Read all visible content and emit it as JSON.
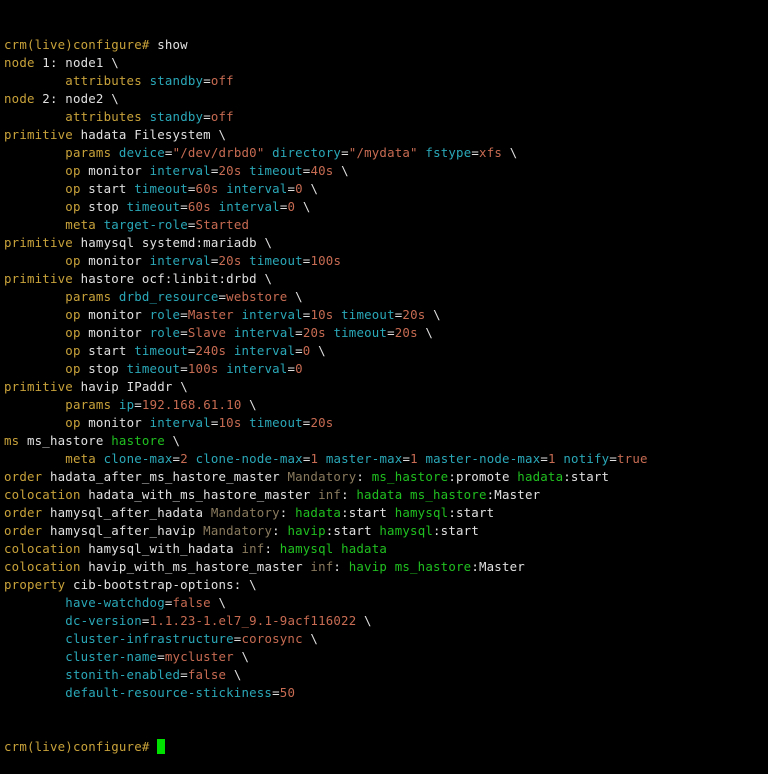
{
  "colors": {
    "background": "#000000",
    "plain": "#e0e0e0",
    "keyword": "#c8a23a",
    "attribute": "#2aa8b8",
    "value": "#c76b52",
    "reference": "#20c020",
    "mandatory": "#8a7b5e",
    "cursor": "#00e000"
  },
  "terminal": {
    "lines": [
      [
        [
          "crm(live)configure#",
          "keyword"
        ],
        [
          " show",
          "plain"
        ]
      ],
      [
        [
          "node",
          "keyword"
        ],
        [
          " 1: node1 \\",
          "plain"
        ]
      ],
      [
        [
          "        ",
          "plain"
        ],
        [
          "attributes",
          "keyword"
        ],
        [
          " ",
          "plain"
        ],
        [
          "standby",
          "attribute"
        ],
        [
          "=",
          "plain"
        ],
        [
          "off",
          "value"
        ]
      ],
      [
        [
          "node",
          "keyword"
        ],
        [
          " 2: node2 \\",
          "plain"
        ]
      ],
      [
        [
          "        ",
          "plain"
        ],
        [
          "attributes",
          "keyword"
        ],
        [
          " ",
          "plain"
        ],
        [
          "standby",
          "attribute"
        ],
        [
          "=",
          "plain"
        ],
        [
          "off",
          "value"
        ]
      ],
      [
        [
          "primitive",
          "keyword"
        ],
        [
          " hadata Filesystem \\",
          "plain"
        ]
      ],
      [
        [
          "        ",
          "plain"
        ],
        [
          "params",
          "keyword"
        ],
        [
          " ",
          "plain"
        ],
        [
          "device",
          "attribute"
        ],
        [
          "=",
          "plain"
        ],
        [
          "\"/dev/drbd0\"",
          "value"
        ],
        [
          " ",
          "plain"
        ],
        [
          "directory",
          "attribute"
        ],
        [
          "=",
          "plain"
        ],
        [
          "\"/mydata\"",
          "value"
        ],
        [
          " ",
          "plain"
        ],
        [
          "fstype",
          "attribute"
        ],
        [
          "=",
          "plain"
        ],
        [
          "xfs",
          "value"
        ],
        [
          " \\",
          "plain"
        ]
      ],
      [
        [
          "        ",
          "plain"
        ],
        [
          "op",
          "keyword"
        ],
        [
          " monitor ",
          "plain"
        ],
        [
          "interval",
          "attribute"
        ],
        [
          "=",
          "plain"
        ],
        [
          "20s",
          "value"
        ],
        [
          " ",
          "plain"
        ],
        [
          "timeout",
          "attribute"
        ],
        [
          "=",
          "plain"
        ],
        [
          "40s",
          "value"
        ],
        [
          " \\",
          "plain"
        ]
      ],
      [
        [
          "        ",
          "plain"
        ],
        [
          "op",
          "keyword"
        ],
        [
          " start ",
          "plain"
        ],
        [
          "timeout",
          "attribute"
        ],
        [
          "=",
          "plain"
        ],
        [
          "60s",
          "value"
        ],
        [
          " ",
          "plain"
        ],
        [
          "interval",
          "attribute"
        ],
        [
          "=",
          "plain"
        ],
        [
          "0",
          "value"
        ],
        [
          " \\",
          "plain"
        ]
      ],
      [
        [
          "        ",
          "plain"
        ],
        [
          "op",
          "keyword"
        ],
        [
          " stop ",
          "plain"
        ],
        [
          "timeout",
          "attribute"
        ],
        [
          "=",
          "plain"
        ],
        [
          "60s",
          "value"
        ],
        [
          " ",
          "plain"
        ],
        [
          "interval",
          "attribute"
        ],
        [
          "=",
          "plain"
        ],
        [
          "0",
          "value"
        ],
        [
          " \\",
          "plain"
        ]
      ],
      [
        [
          "        ",
          "plain"
        ],
        [
          "meta",
          "keyword"
        ],
        [
          " ",
          "plain"
        ],
        [
          "target-role",
          "attribute"
        ],
        [
          "=",
          "plain"
        ],
        [
          "Started",
          "value"
        ]
      ],
      [
        [
          "primitive",
          "keyword"
        ],
        [
          " hamysql systemd:mariadb \\",
          "plain"
        ]
      ],
      [
        [
          "        ",
          "plain"
        ],
        [
          "op",
          "keyword"
        ],
        [
          " monitor ",
          "plain"
        ],
        [
          "interval",
          "attribute"
        ],
        [
          "=",
          "plain"
        ],
        [
          "20s",
          "value"
        ],
        [
          " ",
          "plain"
        ],
        [
          "timeout",
          "attribute"
        ],
        [
          "=",
          "plain"
        ],
        [
          "100s",
          "value"
        ]
      ],
      [
        [
          "primitive",
          "keyword"
        ],
        [
          " hastore ocf:linbit:drbd \\",
          "plain"
        ]
      ],
      [
        [
          "        ",
          "plain"
        ],
        [
          "params",
          "keyword"
        ],
        [
          " ",
          "plain"
        ],
        [
          "drbd_resource",
          "attribute"
        ],
        [
          "=",
          "plain"
        ],
        [
          "webstore",
          "value"
        ],
        [
          " \\",
          "plain"
        ]
      ],
      [
        [
          "        ",
          "plain"
        ],
        [
          "op",
          "keyword"
        ],
        [
          " monitor ",
          "plain"
        ],
        [
          "role",
          "attribute"
        ],
        [
          "=",
          "plain"
        ],
        [
          "Master",
          "value"
        ],
        [
          " ",
          "plain"
        ],
        [
          "interval",
          "attribute"
        ],
        [
          "=",
          "plain"
        ],
        [
          "10s",
          "value"
        ],
        [
          " ",
          "plain"
        ],
        [
          "timeout",
          "attribute"
        ],
        [
          "=",
          "plain"
        ],
        [
          "20s",
          "value"
        ],
        [
          " \\",
          "plain"
        ]
      ],
      [
        [
          "        ",
          "plain"
        ],
        [
          "op",
          "keyword"
        ],
        [
          " monitor ",
          "plain"
        ],
        [
          "role",
          "attribute"
        ],
        [
          "=",
          "plain"
        ],
        [
          "Slave",
          "value"
        ],
        [
          " ",
          "plain"
        ],
        [
          "interval",
          "attribute"
        ],
        [
          "=",
          "plain"
        ],
        [
          "20s",
          "value"
        ],
        [
          " ",
          "plain"
        ],
        [
          "timeout",
          "attribute"
        ],
        [
          "=",
          "plain"
        ],
        [
          "20s",
          "value"
        ],
        [
          " \\",
          "plain"
        ]
      ],
      [
        [
          "        ",
          "plain"
        ],
        [
          "op",
          "keyword"
        ],
        [
          " start ",
          "plain"
        ],
        [
          "timeout",
          "attribute"
        ],
        [
          "=",
          "plain"
        ],
        [
          "240s",
          "value"
        ],
        [
          " ",
          "plain"
        ],
        [
          "interval",
          "attribute"
        ],
        [
          "=",
          "plain"
        ],
        [
          "0",
          "value"
        ],
        [
          " \\",
          "plain"
        ]
      ],
      [
        [
          "        ",
          "plain"
        ],
        [
          "op",
          "keyword"
        ],
        [
          " stop ",
          "plain"
        ],
        [
          "timeout",
          "attribute"
        ],
        [
          "=",
          "plain"
        ],
        [
          "100s",
          "value"
        ],
        [
          " ",
          "plain"
        ],
        [
          "interval",
          "attribute"
        ],
        [
          "=",
          "plain"
        ],
        [
          "0",
          "value"
        ]
      ],
      [
        [
          "primitive",
          "keyword"
        ],
        [
          " havip IPaddr \\",
          "plain"
        ]
      ],
      [
        [
          "        ",
          "plain"
        ],
        [
          "params",
          "keyword"
        ],
        [
          " ",
          "plain"
        ],
        [
          "ip",
          "attribute"
        ],
        [
          "=",
          "plain"
        ],
        [
          "192.168.61.10",
          "value"
        ],
        [
          " \\",
          "plain"
        ]
      ],
      [
        [
          "        ",
          "plain"
        ],
        [
          "op",
          "keyword"
        ],
        [
          " monitor ",
          "plain"
        ],
        [
          "interval",
          "attribute"
        ],
        [
          "=",
          "plain"
        ],
        [
          "10s",
          "value"
        ],
        [
          " ",
          "plain"
        ],
        [
          "timeout",
          "attribute"
        ],
        [
          "=",
          "plain"
        ],
        [
          "20s",
          "value"
        ]
      ],
      [
        [
          "ms",
          "keyword"
        ],
        [
          " ms_hastore ",
          "plain"
        ],
        [
          "hastore",
          "reference"
        ],
        [
          " \\",
          "plain"
        ]
      ],
      [
        [
          "        ",
          "plain"
        ],
        [
          "meta",
          "keyword"
        ],
        [
          " ",
          "plain"
        ],
        [
          "clone-max",
          "attribute"
        ],
        [
          "=",
          "plain"
        ],
        [
          "2",
          "value"
        ],
        [
          " ",
          "plain"
        ],
        [
          "clone-node-max",
          "attribute"
        ],
        [
          "=",
          "plain"
        ],
        [
          "1",
          "value"
        ],
        [
          " ",
          "plain"
        ],
        [
          "master-max",
          "attribute"
        ],
        [
          "=",
          "plain"
        ],
        [
          "1",
          "value"
        ],
        [
          " ",
          "plain"
        ],
        [
          "master-node-max",
          "attribute"
        ],
        [
          "=",
          "plain"
        ],
        [
          "1",
          "value"
        ],
        [
          " ",
          "plain"
        ],
        [
          "notify",
          "attribute"
        ],
        [
          "=",
          "plain"
        ],
        [
          "true",
          "value"
        ]
      ],
      [
        [
          "order",
          "keyword"
        ],
        [
          " hadata_after_ms_hastore_master ",
          "plain"
        ],
        [
          "Mandatory",
          "mandatory"
        ],
        [
          ": ",
          "plain"
        ],
        [
          "ms_hastore",
          "reference"
        ],
        [
          ":promote ",
          "plain"
        ],
        [
          "hadata",
          "reference"
        ],
        [
          ":start",
          "plain"
        ]
      ],
      [
        [
          "colocation",
          "keyword"
        ],
        [
          " hadata_with_ms_hastore_master ",
          "plain"
        ],
        [
          "inf",
          "mandatory"
        ],
        [
          ": ",
          "plain"
        ],
        [
          "hadata",
          "reference"
        ],
        [
          " ",
          "plain"
        ],
        [
          "ms_hastore",
          "reference"
        ],
        [
          ":Master",
          "plain"
        ]
      ],
      [
        [
          "order",
          "keyword"
        ],
        [
          " hamysql_after_hadata ",
          "plain"
        ],
        [
          "Mandatory",
          "mandatory"
        ],
        [
          ": ",
          "plain"
        ],
        [
          "hadata",
          "reference"
        ],
        [
          ":start ",
          "plain"
        ],
        [
          "hamysql",
          "reference"
        ],
        [
          ":start",
          "plain"
        ]
      ],
      [
        [
          "order",
          "keyword"
        ],
        [
          " hamysql_after_havip ",
          "plain"
        ],
        [
          "Mandatory",
          "mandatory"
        ],
        [
          ": ",
          "plain"
        ],
        [
          "havip",
          "reference"
        ],
        [
          ":start ",
          "plain"
        ],
        [
          "hamysql",
          "reference"
        ],
        [
          ":start",
          "plain"
        ]
      ],
      [
        [
          "colocation",
          "keyword"
        ],
        [
          " hamysql_with_hadata ",
          "plain"
        ],
        [
          "inf",
          "mandatory"
        ],
        [
          ": ",
          "plain"
        ],
        [
          "hamysql",
          "reference"
        ],
        [
          " ",
          "plain"
        ],
        [
          "hadata",
          "reference"
        ]
      ],
      [
        [
          "colocation",
          "keyword"
        ],
        [
          " havip_with_ms_hastore_master ",
          "plain"
        ],
        [
          "inf",
          "mandatory"
        ],
        [
          ": ",
          "plain"
        ],
        [
          "havip",
          "reference"
        ],
        [
          " ",
          "plain"
        ],
        [
          "ms_hastore",
          "reference"
        ],
        [
          ":Master",
          "plain"
        ]
      ],
      [
        [
          "property",
          "keyword"
        ],
        [
          " cib-bootstrap-options: \\",
          "plain"
        ]
      ],
      [
        [
          "        ",
          "plain"
        ],
        [
          "have-watchdog",
          "attribute"
        ],
        [
          "=",
          "plain"
        ],
        [
          "false",
          "value"
        ],
        [
          " \\",
          "plain"
        ]
      ],
      [
        [
          "        ",
          "plain"
        ],
        [
          "dc-version",
          "attribute"
        ],
        [
          "=",
          "plain"
        ],
        [
          "1.1.23-1.el7_9.1-9acf116022",
          "value"
        ],
        [
          " \\",
          "plain"
        ]
      ],
      [
        [
          "        ",
          "plain"
        ],
        [
          "cluster-infrastructure",
          "attribute"
        ],
        [
          "=",
          "plain"
        ],
        [
          "corosync",
          "value"
        ],
        [
          " \\",
          "plain"
        ]
      ],
      [
        [
          "        ",
          "plain"
        ],
        [
          "cluster-name",
          "attribute"
        ],
        [
          "=",
          "plain"
        ],
        [
          "mycluster",
          "value"
        ],
        [
          " \\",
          "plain"
        ]
      ],
      [
        [
          "        ",
          "plain"
        ],
        [
          "stonith-enabled",
          "attribute"
        ],
        [
          "=",
          "plain"
        ],
        [
          "false",
          "value"
        ],
        [
          " \\",
          "plain"
        ]
      ],
      [
        [
          "        ",
          "plain"
        ],
        [
          "default-resource-stickiness",
          "attribute"
        ],
        [
          "=",
          "plain"
        ],
        [
          "50",
          "value"
        ]
      ]
    ],
    "prompt": "crm(live)configure#",
    "input": " "
  }
}
